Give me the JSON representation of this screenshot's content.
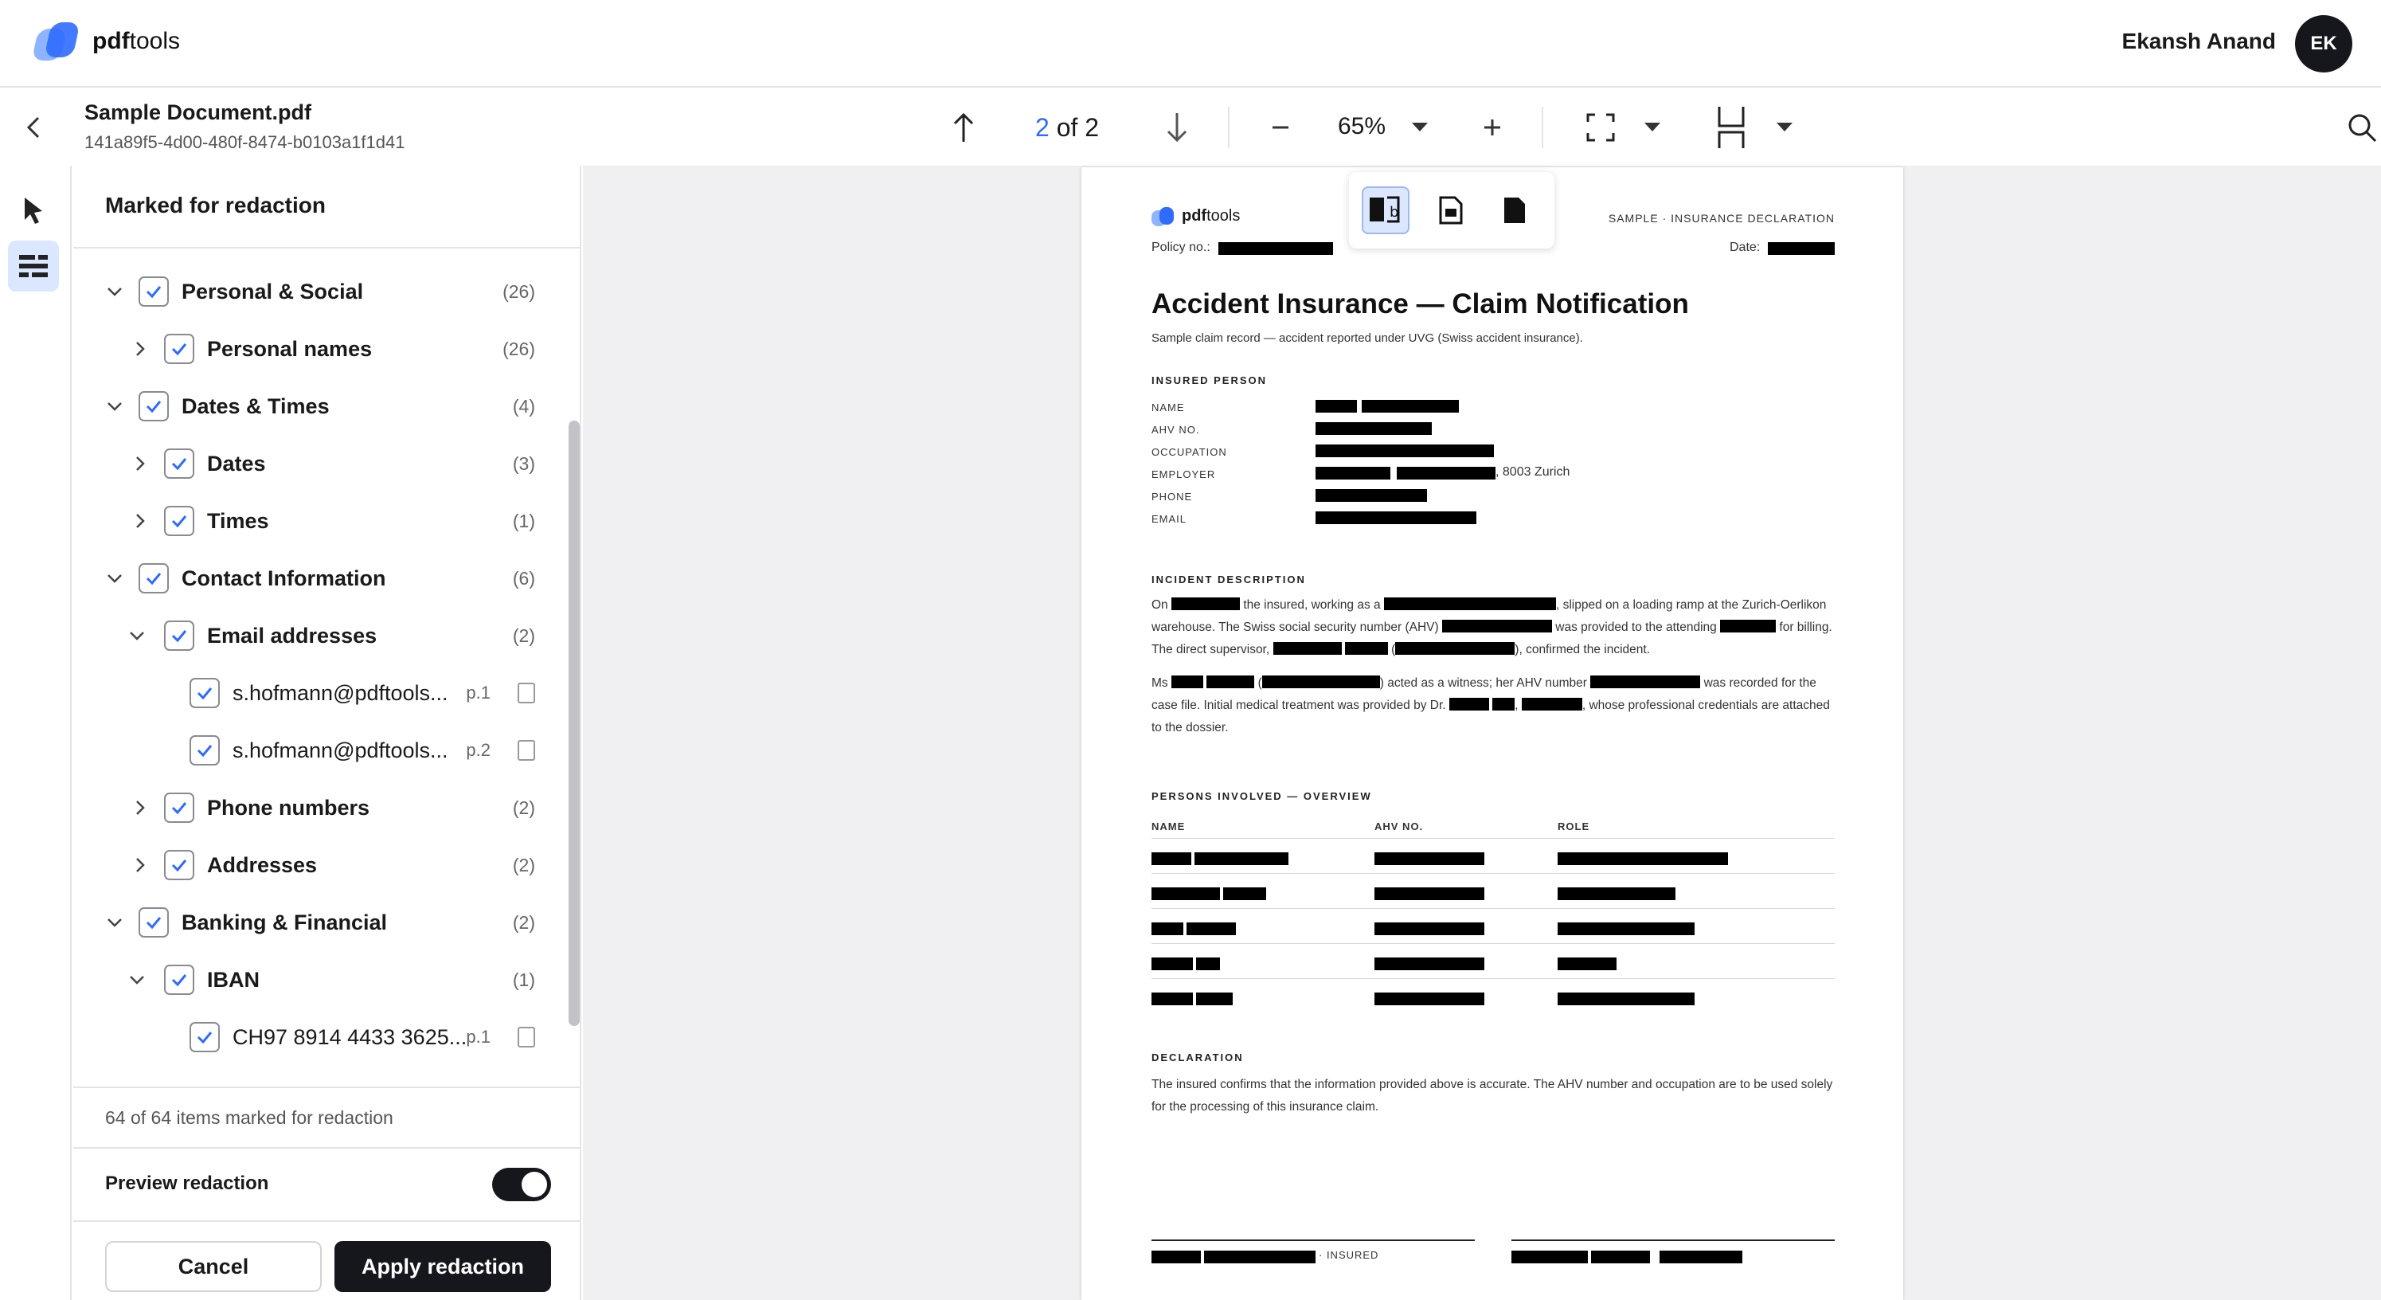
{
  "app": {
    "brand_prefix": "pdf",
    "brand_suffix": "tools",
    "user_name": "Ekansh Anand",
    "user_initials": "EK"
  },
  "document": {
    "title": "Sample Document.pdf",
    "id": "141a89f5-4d00-480f-8474-b0103a1f1d41"
  },
  "toolbar": {
    "page_current": "2",
    "page_of": "of 2",
    "zoom": "65%"
  },
  "panel": {
    "title": "Marked for redaction",
    "rows": [
      {
        "label": "Personal & Social",
        "count": "(26)"
      },
      {
        "label": "Personal names",
        "count": "(26)"
      },
      {
        "label": "Dates & Times",
        "count": "(4)"
      },
      {
        "label": "Dates",
        "count": "(3)"
      },
      {
        "label": "Times",
        "count": "(1)"
      },
      {
        "label": "Contact Information",
        "count": "(6)"
      },
      {
        "label": "Email addresses",
        "count": "(2)"
      },
      {
        "label": "s.hofmann@pdftools...",
        "page": "p.1"
      },
      {
        "label": "s.hofmann@pdftools...",
        "page": "p.2"
      },
      {
        "label": "Phone numbers",
        "count": "(2)"
      },
      {
        "label": "Addresses",
        "count": "(2)"
      },
      {
        "label": "Banking & Financial",
        "count": "(2)"
      },
      {
        "label": "IBAN",
        "count": "(1)"
      },
      {
        "label": "CH97 8914 4433 3625...",
        "page": "p.1"
      }
    ],
    "summary": "64 of 64 items marked for redaction",
    "preview_label": "Preview redaction",
    "preview_on": true,
    "cancel_label": "Cancel",
    "apply_label": "Apply redaction"
  },
  "pdf": {
    "logo_prefix": "pdf",
    "logo_suffix": "tools",
    "header_right": "SAMPLE · INSURANCE DECLARATION",
    "policy_label": "Policy no.:",
    "date_label": "Date:",
    "title": "Accident Insurance — Claim Notification",
    "subtitle": "Sample claim record — accident reported under UVG (Swiss accident insurance).",
    "insured_heading": "INSURED PERSON",
    "field_name": "NAME",
    "field_ahv": "AHV NO.",
    "field_occupation": "OCCUPATION",
    "field_employer": "EMPLOYER",
    "field_phone": "PHONE",
    "field_email": "EMAIL",
    "employer_city": ", 8003 Zurich",
    "incident_heading": "INCIDENT DESCRIPTION",
    "p1_a": "On",
    "p1_b": "the insured, working as a",
    "p1_c": ", slipped on a loading ramp at the Zurich-Oerlikon warehouse. The Swiss social security number (AHV)",
    "p1_d": "was provided to the attending",
    "p1_e": "for billing. The direct supervisor,",
    "p1_f": "(",
    "p1_g": "), confirmed the incident.",
    "p2_a": "Ms",
    "p2_b": "(",
    "p2_c": ") acted as a witness; her AHV number",
    "p2_d": "was recorded for the case file. Initial medical treatment was provided by Dr.",
    "p2_e": ",",
    "p2_f": ", whose professional credentials are attached to the dossier.",
    "persons_heading": "PERSONS INVOLVED — OVERVIEW",
    "col_name": "NAME",
    "col_ahv": "AHV NO.",
    "col_role": "ROLE",
    "declaration_heading": "DECLARATION",
    "declaration_text": "The insured confirms that the information provided above is accurate. The AHV number and occupation are to be used solely for the processing of this insurance claim.",
    "sig_insured": "· INSURED"
  },
  "colors": {
    "accent": "#2f6bff",
    "dark": "#16161d",
    "selected_bg": "#dbe7ff"
  }
}
